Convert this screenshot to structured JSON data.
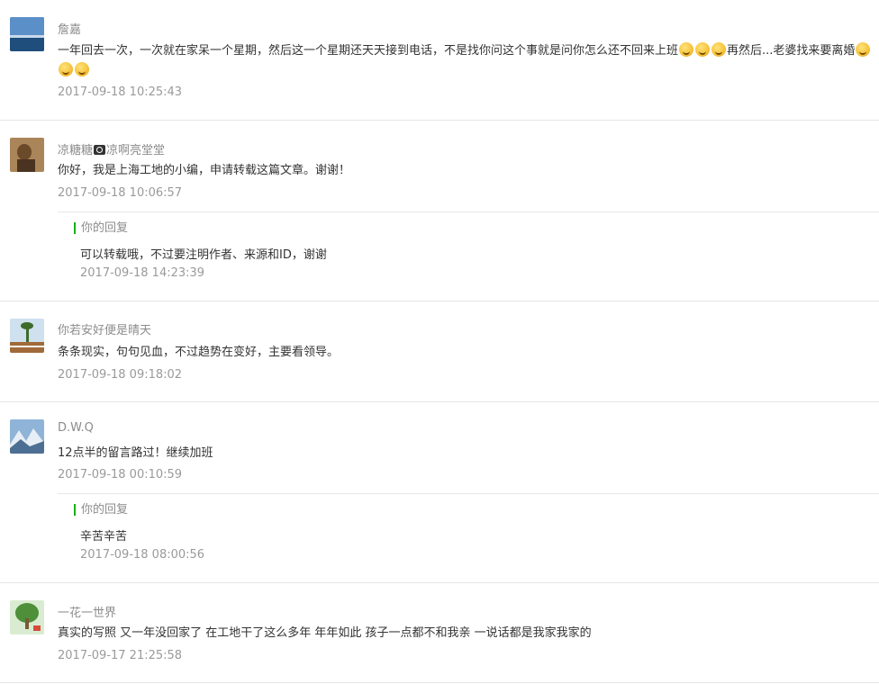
{
  "comments": [
    {
      "nickname": "詹嘉",
      "content_part1": "一年回去一次，一次就在家呆一个星期，然后这一个星期还天天接到电话，不是找你问这个事就是问你怎么还不回来上班",
      "content_part2": "再然后...老婆找来要离婚",
      "time": "2017-09-18 10:25:43"
    },
    {
      "nickname_part1": "凉糖糖",
      "nickname_part2": "凉啊亮堂堂",
      "content": "你好，我是上海工地的小编，申请转载这篇文章。谢谢！",
      "time": "2017-09-18 10:06:57",
      "reply": {
        "label": "你的回复",
        "content": "可以转载哦，不过要注明作者、来源和ID，谢谢",
        "time": "2017-09-18 14:23:39"
      }
    },
    {
      "nickname": "你若安好便是晴天",
      "content": "条条现实，句句见血，不过趋势在变好，主要看领导。",
      "time": "2017-09-18 09:18:02"
    },
    {
      "nickname": "D.W.Q",
      "content": "12点半的留言路过！继续加班",
      "time": "2017-09-18 00:10:59",
      "reply": {
        "label": "你的回复",
        "content": "辛苦辛苦",
        "time": "2017-09-18 08:00:56"
      }
    },
    {
      "nickname": "一花一世界",
      "content": "真实的写照 又一年没回家了 在工地干了这么多年 年年如此 孩子一点都不和我亲 一说话都是我家我家的",
      "time": "2017-09-17 21:25:58"
    }
  ]
}
